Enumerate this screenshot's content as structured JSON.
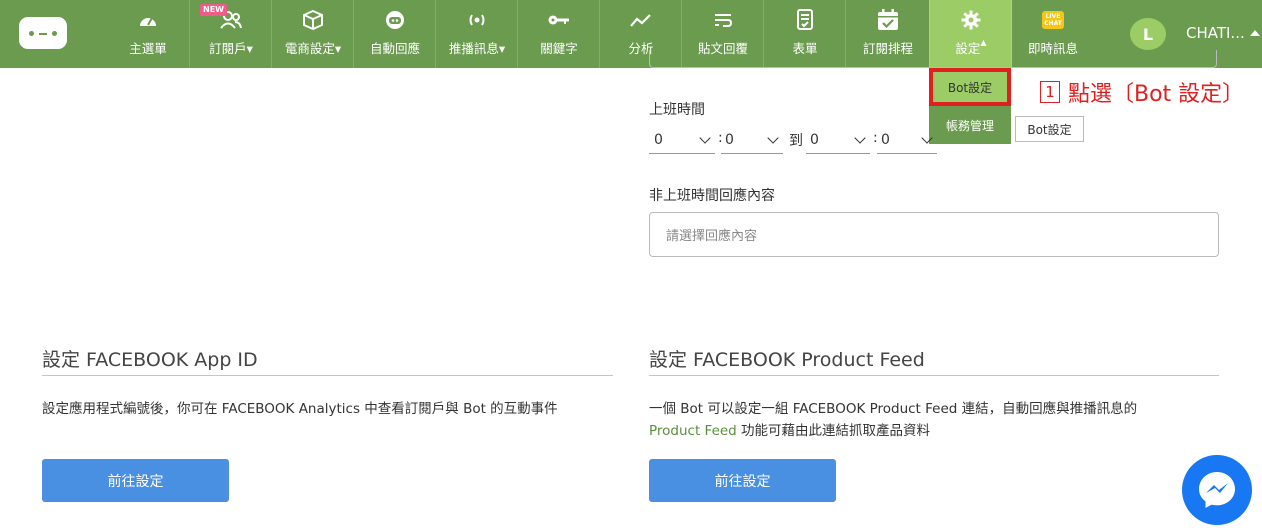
{
  "nav": {
    "items": [
      {
        "label": "主選單",
        "icon": "dashboard-icon"
      },
      {
        "label": "訂閱戶▾",
        "icon": "users-icon",
        "badge": "NEW"
      },
      {
        "label": "電商設定▾",
        "icon": "box-icon"
      },
      {
        "label": "自動回應",
        "icon": "bot-icon"
      },
      {
        "label": "推播訊息▾",
        "icon": "broadcast-icon"
      },
      {
        "label": "關鍵字",
        "icon": "key-icon"
      },
      {
        "label": "分析",
        "icon": "chart-icon"
      },
      {
        "label": "貼文回覆",
        "icon": "wrap-icon"
      },
      {
        "label": "表單",
        "icon": "form-icon"
      },
      {
        "label": "訂閱排程",
        "icon": "calendar-icon"
      },
      {
        "label": "設定",
        "icon": "gear-icon"
      },
      {
        "label": "即時訊息",
        "icon": "live-chat-icon",
        "badge_lines": [
          "LIVE",
          "CHAT"
        ]
      }
    ],
    "avatar_letter": "L",
    "account_name": "CHATI..."
  },
  "dropdown": {
    "items": [
      "Bot設定",
      "帳務管理"
    ],
    "tooltip": "Bot設定"
  },
  "annotation": {
    "number": "1",
    "text": "點選〔Bot 設定〕"
  },
  "office_hours": {
    "label": "上班時間",
    "start_hour": "0",
    "start_min": "0",
    "to": "到",
    "end_hour": "0",
    "end_min": "0",
    "colon": ":"
  },
  "off_hours": {
    "label": "非上班時間回應內容",
    "placeholder": "請選擇回應內容"
  },
  "fb_app": {
    "title": "設定 FACEBOOK App ID",
    "desc": "設定應用程式編號後，你可在 FACEBOOK Analytics 中查看訂閱戶與 Bot 的互動事件",
    "button": "前往設定"
  },
  "fb_feed": {
    "title": "設定 FACEBOOK Product Feed",
    "desc_line1": "一個 Bot 可以設定一組 FACEBOOK Product Feed 連結，自動回應與推播訊息的",
    "desc_highlight": "Product Feed",
    "desc_line2_rest": " 功能可藉由此連結抓取產品資料",
    "button": "前往設定"
  },
  "colors": {
    "nav_bg": "#6a9b4f",
    "active": "#9ccc65",
    "primary_button": "#4a90e2",
    "annotation": "#e02020"
  }
}
